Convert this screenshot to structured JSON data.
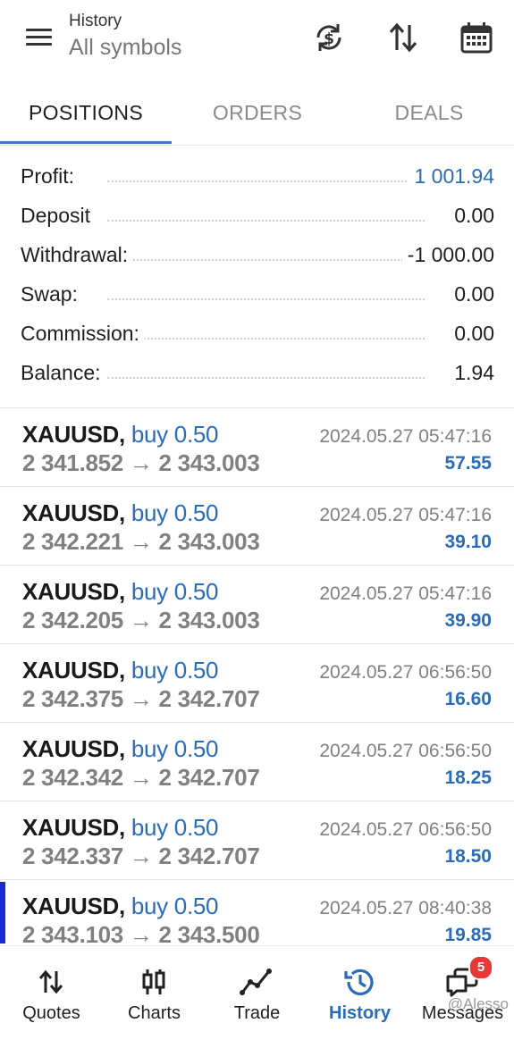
{
  "header": {
    "title": "History",
    "subtitle": "All symbols"
  },
  "tabs": [
    {
      "label": "POSITIONS",
      "active": true
    },
    {
      "label": "ORDERS",
      "active": false
    },
    {
      "label": "DEALS",
      "active": false
    }
  ],
  "summary": {
    "profit": {
      "label": "Profit:",
      "value": "1 001.94"
    },
    "deposit": {
      "label": "Deposit",
      "value": "0.00"
    },
    "withdrawal": {
      "label": "Withdrawal:",
      "value": "-1 000.00"
    },
    "swap": {
      "label": "Swap:",
      "value": "0.00"
    },
    "commission": {
      "label": "Commission:",
      "value": "0.00"
    },
    "balance": {
      "label": "Balance:",
      "value": "1.94"
    }
  },
  "deals": [
    {
      "symbol": "XAUUSD,",
      "side": "buy 0.50",
      "prices": "2 341.852 → 2 343.003",
      "time": "2024.05.27 05:47:16",
      "profit": "57.55"
    },
    {
      "symbol": "XAUUSD,",
      "side": "buy 0.50",
      "prices": "2 342.221 → 2 343.003",
      "time": "2024.05.27 05:47:16",
      "profit": "39.10"
    },
    {
      "symbol": "XAUUSD,",
      "side": "buy 0.50",
      "prices": "2 342.205 → 2 343.003",
      "time": "2024.05.27 05:47:16",
      "profit": "39.90"
    },
    {
      "symbol": "XAUUSD,",
      "side": "buy 0.50",
      "prices": "2 342.375 → 2 342.707",
      "time": "2024.05.27 06:56:50",
      "profit": "16.60"
    },
    {
      "symbol": "XAUUSD,",
      "side": "buy 0.50",
      "prices": "2 342.342 → 2 342.707",
      "time": "2024.05.27 06:56:50",
      "profit": "18.25"
    },
    {
      "symbol": "XAUUSD,",
      "side": "buy 0.50",
      "prices": "2 342.337 → 2 342.707",
      "time": "2024.05.27 06:56:50",
      "profit": "18.50"
    },
    {
      "symbol": "XAUUSD,",
      "side": "buy 0.50",
      "prices": "2 343.103 → 2 343.500",
      "time": "2024.05.27 08:40:38",
      "profit": "19.85"
    }
  ],
  "bottom_nav": [
    {
      "label": "Quotes",
      "icon": "quotes-icon",
      "active": false
    },
    {
      "label": "Charts",
      "icon": "charts-icon",
      "active": false
    },
    {
      "label": "Trade",
      "icon": "trade-icon",
      "active": false
    },
    {
      "label": "History",
      "icon": "history-icon",
      "active": true
    },
    {
      "label": "Messages",
      "icon": "messages-icon",
      "active": false,
      "badge": "5"
    }
  ],
  "watermark": "@Alesso",
  "colors": {
    "accent": "#2b6cb8",
    "selected_marker": "#1a2ad8",
    "badge": "#e53935"
  }
}
